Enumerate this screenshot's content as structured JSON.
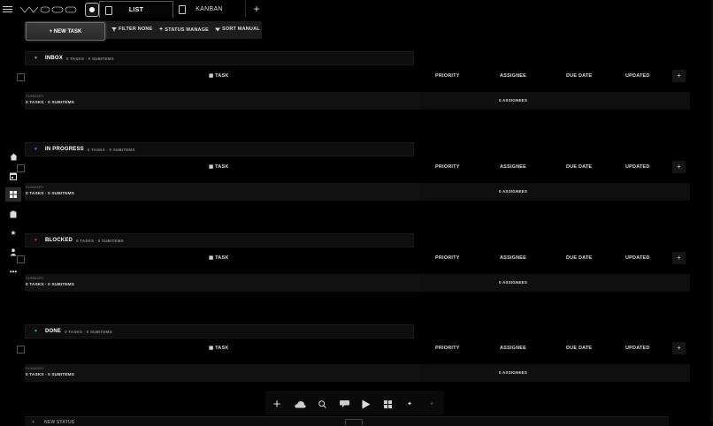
{
  "app": {
    "logo_text": "WSOO"
  },
  "tabs": [
    {
      "label": "LIST",
      "active": true
    },
    {
      "label": "KANBAN",
      "active": false
    }
  ],
  "toolbar": {
    "new_task": "+ NEW TASK",
    "filter": "FILTER NONE",
    "status": "STATUS MANAGE",
    "sort": "SORT MANUAL"
  },
  "columns": {
    "task": "TASK",
    "priority": "PRIORITY",
    "assignee": "ASSIGNEE",
    "due_date": "DUE DATE",
    "updated": "UPDATED"
  },
  "groups": [
    {
      "name": "INBOX",
      "count": "0 TASKS · 0 SUBITEMS",
      "summary_label": "SUMMARY",
      "summary_text": "0 TASKS · 0 SUBITEMS",
      "assignees": "0 ASSIGNEES",
      "color": "#9a9a9a"
    },
    {
      "name": "IN PROGRESS",
      "count": "0 TASKS · 0 SUBITEMS",
      "summary_label": "SUMMARY",
      "summary_text": "0 TASKS · 0 SUBITEMS",
      "assignees": "0 ASSIGNEES",
      "color": "#3d7bd9"
    },
    {
      "name": "BLOCKED",
      "count": "0 TASKS · 0 SUBITEMS",
      "summary_label": "SUMMARY",
      "summary_text": "0 TASKS · 0 SUBITEMS",
      "assignees": "0 ASSIGNEES",
      "color": "#d23b3b"
    },
    {
      "name": "DONE",
      "count": "0 TASKS · 0 SUBITEMS",
      "summary_label": "SUMMARY",
      "summary_text": "0 TASKS · 0 SUBITEMS",
      "assignees": "0 ASSIGNEES",
      "color": "#3fb35a"
    }
  ],
  "new_status": {
    "label": "NEW STATUS"
  },
  "sidebar_icons": [
    "home-icon",
    "calendar-icon",
    "grid-icon",
    "clipboard-icon",
    "star-icon",
    "user-icon",
    "more-icon"
  ],
  "bottom_icons": [
    "plus-icon",
    "cloud-icon",
    "search-icon",
    "chat-icon",
    "play-icon",
    "grid-icon",
    "sparkle-icon",
    "plus-small-icon"
  ]
}
